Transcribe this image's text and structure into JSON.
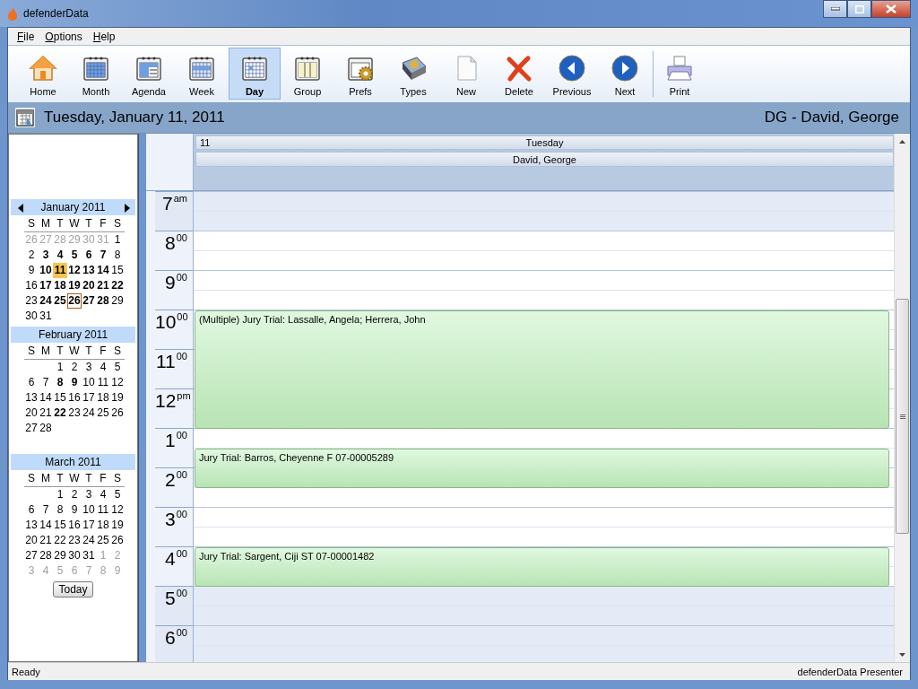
{
  "window": {
    "title": "defenderData"
  },
  "menu": [
    {
      "label": "File"
    },
    {
      "label": "Options"
    },
    {
      "label": "Help"
    }
  ],
  "toolbar": {
    "groups": [
      {
        "buttons": [
          {
            "label": "Home",
            "selected": false
          },
          {
            "label": "Month",
            "selected": false
          },
          {
            "label": "Agenda",
            "selected": false
          },
          {
            "label": "Week",
            "selected": false
          },
          {
            "label": "Day",
            "selected": true
          },
          {
            "label": "Group",
            "selected": false
          },
          {
            "label": "Prefs",
            "selected": false
          },
          {
            "label": "Types",
            "selected": false
          },
          {
            "label": "New",
            "selected": false
          },
          {
            "label": "Delete",
            "selected": false
          },
          {
            "label": "Previous",
            "selected": false
          },
          {
            "label": "Next",
            "selected": false
          }
        ]
      },
      {
        "buttons": [
          {
            "label": "Print",
            "selected": false
          }
        ]
      }
    ]
  },
  "date_header": {
    "date": "Tuesday, January 11, 2011",
    "person": "DG - David, George"
  },
  "mini_calendar": {
    "months": [
      {
        "title": "January 2011",
        "nav": true,
        "weekdays": [
          "S",
          "M",
          "T",
          "W",
          "T",
          "F",
          "S"
        ],
        "weeks": [
          [
            {
              "day": "26",
              "muted": true,
              "bold": false,
              "selected": false,
              "today": false
            },
            {
              "day": "27",
              "muted": true,
              "bold": false,
              "selected": false,
              "today": false
            },
            {
              "day": "28",
              "muted": true,
              "bold": false,
              "selected": false,
              "today": false
            },
            {
              "day": "29",
              "muted": true,
              "bold": false,
              "selected": false,
              "today": false
            },
            {
              "day": "30",
              "muted": true,
              "bold": false,
              "selected": false,
              "today": false
            },
            {
              "day": "31",
              "muted": true,
              "bold": false,
              "selected": false,
              "today": false
            },
            {
              "day": "1",
              "muted": false,
              "bold": false,
              "selected": false,
              "today": false
            }
          ],
          [
            {
              "day": "2",
              "muted": false,
              "bold": false,
              "selected": false,
              "today": false
            },
            {
              "day": "3",
              "muted": false,
              "bold": true,
              "selected": false,
              "today": false
            },
            {
              "day": "4",
              "muted": false,
              "bold": true,
              "selected": false,
              "today": false
            },
            {
              "day": "5",
              "muted": false,
              "bold": true,
              "selected": false,
              "today": false
            },
            {
              "day": "6",
              "muted": false,
              "bold": true,
              "selected": false,
              "today": false
            },
            {
              "day": "7",
              "muted": false,
              "bold": true,
              "selected": false,
              "today": false
            },
            {
              "day": "8",
              "muted": false,
              "bold": false,
              "selected": false,
              "today": false
            }
          ],
          [
            {
              "day": "9",
              "muted": false,
              "bold": false,
              "selected": false,
              "today": false
            },
            {
              "day": "10",
              "muted": false,
              "bold": true,
              "selected": false,
              "today": false
            },
            {
              "day": "11",
              "muted": false,
              "bold": true,
              "selected": true,
              "today": false
            },
            {
              "day": "12",
              "muted": false,
              "bold": true,
              "selected": false,
              "today": false
            },
            {
              "day": "13",
              "muted": false,
              "bold": true,
              "selected": false,
              "today": false
            },
            {
              "day": "14",
              "muted": false,
              "bold": true,
              "selected": false,
              "today": false
            },
            {
              "day": "15",
              "muted": false,
              "bold": false,
              "selected": false,
              "today": false
            }
          ],
          [
            {
              "day": "16",
              "muted": false,
              "bold": false,
              "selected": false,
              "today": false
            },
            {
              "day": "17",
              "muted": false,
              "bold": true,
              "selected": false,
              "today": false
            },
            {
              "day": "18",
              "muted": false,
              "bold": true,
              "selected": false,
              "today": false
            },
            {
              "day": "19",
              "muted": false,
              "bold": true,
              "selected": false,
              "today": false
            },
            {
              "day": "20",
              "muted": false,
              "bold": true,
              "selected": false,
              "today": false
            },
            {
              "day": "21",
              "muted": false,
              "bold": true,
              "selected": false,
              "today": false
            },
            {
              "day": "22",
              "muted": false,
              "bold": true,
              "selected": false,
              "today": false
            }
          ],
          [
            {
              "day": "23",
              "muted": false,
              "bold": false,
              "selected": false,
              "today": false
            },
            {
              "day": "24",
              "muted": false,
              "bold": true,
              "selected": false,
              "today": false
            },
            {
              "day": "25",
              "muted": false,
              "bold": true,
              "selected": false,
              "today": false
            },
            {
              "day": "26",
              "muted": false,
              "bold": true,
              "selected": false,
              "today": true
            },
            {
              "day": "27",
              "muted": false,
              "bold": true,
              "selected": false,
              "today": false
            },
            {
              "day": "28",
              "muted": false,
              "bold": true,
              "selected": false,
              "today": false
            },
            {
              "day": "29",
              "muted": false,
              "bold": false,
              "selected": false,
              "today": false
            }
          ],
          [
            {
              "day": "30",
              "muted": false,
              "bold": false,
              "selected": false,
              "today": false
            },
            {
              "day": "31",
              "muted": false,
              "bold": false,
              "selected": false,
              "today": false
            }
          ]
        ]
      },
      {
        "title": "February 2011",
        "nav": false,
        "weekdays": [
          "S",
          "M",
          "T",
          "W",
          "T",
          "F",
          "S"
        ],
        "weeks": [
          [
            {
              "day": "1",
              "muted": false,
              "bold": false,
              "selected": false,
              "today": false
            },
            {
              "day": "2",
              "muted": false,
              "bold": false,
              "selected": false,
              "today": false
            },
            {
              "day": "3",
              "muted": false,
              "bold": false,
              "selected": false,
              "today": false
            },
            {
              "day": "4",
              "muted": false,
              "bold": false,
              "selected": false,
              "today": false
            },
            {
              "day": "5",
              "muted": false,
              "bold": false,
              "selected": false,
              "today": false
            }
          ],
          [
            {
              "day": "6",
              "muted": false,
              "bold": false,
              "selected": false,
              "today": false
            },
            {
              "day": "7",
              "muted": false,
              "bold": false,
              "selected": false,
              "today": false
            },
            {
              "day": "8",
              "muted": false,
              "bold": true,
              "selected": false,
              "today": false
            },
            {
              "day": "9",
              "muted": false,
              "bold": true,
              "selected": false,
              "today": false
            },
            {
              "day": "10",
              "muted": false,
              "bold": false,
              "selected": false,
              "today": false
            },
            {
              "day": "11",
              "muted": false,
              "bold": false,
              "selected": false,
              "today": false
            },
            {
              "day": "12",
              "muted": false,
              "bold": false,
              "selected": false,
              "today": false
            }
          ],
          [
            {
              "day": "13",
              "muted": false,
              "bold": false,
              "selected": false,
              "today": false
            },
            {
              "day": "14",
              "muted": false,
              "bold": false,
              "selected": false,
              "today": false
            },
            {
              "day": "15",
              "muted": false,
              "bold": false,
              "selected": false,
              "today": false
            },
            {
              "day": "16",
              "muted": false,
              "bold": false,
              "selected": false,
              "today": false
            },
            {
              "day": "17",
              "muted": false,
              "bold": false,
              "selected": false,
              "today": false
            },
            {
              "day": "18",
              "muted": false,
              "bold": false,
              "selected": false,
              "today": false
            },
            {
              "day": "19",
              "muted": false,
              "bold": false,
              "selected": false,
              "today": false
            }
          ],
          [
            {
              "day": "20",
              "muted": false,
              "bold": false,
              "selected": false,
              "today": false
            },
            {
              "day": "21",
              "muted": false,
              "bold": false,
              "selected": false,
              "today": false
            },
            {
              "day": "22",
              "muted": false,
              "bold": true,
              "selected": false,
              "today": false
            },
            {
              "day": "23",
              "muted": false,
              "bold": false,
              "selected": false,
              "today": false
            },
            {
              "day": "24",
              "muted": false,
              "bold": false,
              "selected": false,
              "today": false
            },
            {
              "day": "25",
              "muted": false,
              "bold": false,
              "selected": false,
              "today": false
            },
            {
              "day": "26",
              "muted": false,
              "bold": false,
              "selected": false,
              "today": false
            }
          ],
          [
            {
              "day": "27",
              "muted": false,
              "bold": false,
              "selected": false,
              "today": false
            },
            {
              "day": "28",
              "muted": false,
              "bold": false,
              "selected": false,
              "today": false
            }
          ]
        ]
      },
      {
        "title": "March 2011",
        "nav": false,
        "weekdays": [
          "S",
          "M",
          "T",
          "W",
          "T",
          "F",
          "S"
        ],
        "weeks": [
          [
            {
              "day": "1",
              "muted": false,
              "bold": false,
              "selected": false,
              "today": false
            },
            {
              "day": "2",
              "muted": false,
              "bold": false,
              "selected": false,
              "today": false
            },
            {
              "day": "3",
              "muted": false,
              "bold": false,
              "selected": false,
              "today": false
            },
            {
              "day": "4",
              "muted": false,
              "bold": false,
              "selected": false,
              "today": false
            },
            {
              "day": "5",
              "muted": false,
              "bold": false,
              "selected": false,
              "today": false
            }
          ],
          [
            {
              "day": "6",
              "muted": false,
              "bold": false,
              "selected": false,
              "today": false
            },
            {
              "day": "7",
              "muted": false,
              "bold": false,
              "selected": false,
              "today": false
            },
            {
              "day": "8",
              "muted": false,
              "bold": false,
              "selected": false,
              "today": false
            },
            {
              "day": "9",
              "muted": false,
              "bold": false,
              "selected": false,
              "today": false
            },
            {
              "day": "10",
              "muted": false,
              "bold": false,
              "selected": false,
              "today": false
            },
            {
              "day": "11",
              "muted": false,
              "bold": false,
              "selected": false,
              "today": false
            },
            {
              "day": "12",
              "muted": false,
              "bold": false,
              "selected": false,
              "today": false
            }
          ],
          [
            {
              "day": "13",
              "muted": false,
              "bold": false,
              "selected": false,
              "today": false
            },
            {
              "day": "14",
              "muted": false,
              "bold": false,
              "selected": false,
              "today": false
            },
            {
              "day": "15",
              "muted": false,
              "bold": false,
              "selected": false,
              "today": false
            },
            {
              "day": "16",
              "muted": false,
              "bold": false,
              "selected": false,
              "today": false
            },
            {
              "day": "17",
              "muted": false,
              "bold": false,
              "selected": false,
              "today": false
            },
            {
              "day": "18",
              "muted": false,
              "bold": false,
              "selected": false,
              "today": false
            },
            {
              "day": "19",
              "muted": false,
              "bold": false,
              "selected": false,
              "today": false
            }
          ],
          [
            {
              "day": "20",
              "muted": false,
              "bold": false,
              "selected": false,
              "today": false
            },
            {
              "day": "21",
              "muted": false,
              "bold": false,
              "selected": false,
              "today": false
            },
            {
              "day": "22",
              "muted": false,
              "bold": false,
              "selected": false,
              "today": false
            },
            {
              "day": "23",
              "muted": false,
              "bold": false,
              "selected": false,
              "today": false
            },
            {
              "day": "24",
              "muted": false,
              "bold": false,
              "selected": false,
              "today": false
            },
            {
              "day": "25",
              "muted": false,
              "bold": false,
              "selected": false,
              "today": false
            },
            {
              "day": "26",
              "muted": false,
              "bold": false,
              "selected": false,
              "today": false
            }
          ],
          [
            {
              "day": "27",
              "muted": false,
              "bold": false,
              "selected": false,
              "today": false
            },
            {
              "day": "28",
              "muted": false,
              "bold": false,
              "selected": false,
              "today": false
            },
            {
              "day": "29",
              "muted": false,
              "bold": false,
              "selected": false,
              "today": false
            },
            {
              "day": "30",
              "muted": false,
              "bold": false,
              "selected": false,
              "today": false
            },
            {
              "day": "31",
              "muted": false,
              "bold": false,
              "selected": false,
              "today": false
            },
            {
              "day": "1",
              "muted": true,
              "bold": false,
              "selected": false,
              "today": false
            },
            {
              "day": "2",
              "muted": true,
              "bold": false,
              "selected": false,
              "today": false
            }
          ],
          [
            {
              "day": "3",
              "muted": true,
              "bold": false,
              "selected": false,
              "today": false
            },
            {
              "day": "4",
              "muted": true,
              "bold": false,
              "selected": false,
              "today": false
            },
            {
              "day": "5",
              "muted": true,
              "bold": false,
              "selected": false,
              "today": false
            },
            {
              "day": "6",
              "muted": true,
              "bold": false,
              "selected": false,
              "today": false
            },
            {
              "day": "7",
              "muted": true,
              "bold": false,
              "selected": false,
              "today": false
            },
            {
              "day": "8",
              "muted": true,
              "bold": false,
              "selected": false,
              "today": false
            },
            {
              "day": "9",
              "muted": true,
              "bold": false,
              "selected": false,
              "today": false
            }
          ]
        ]
      }
    ],
    "today_button": "Today"
  },
  "day_view": {
    "date_number": "11",
    "weekday": "Tuesday",
    "resource": "David, George",
    "hours": [
      {
        "hour": "7",
        "suffix": "am",
        "working": false,
        "halves": [
          {
            "busy": false
          },
          {
            "busy": false
          }
        ]
      },
      {
        "hour": "8",
        "suffix": "00",
        "working": true,
        "halves": [
          {
            "busy": false
          },
          {
            "busy": false
          }
        ]
      },
      {
        "hour": "9",
        "suffix": "00",
        "working": true,
        "halves": [
          {
            "busy": false
          },
          {
            "busy": false
          }
        ]
      },
      {
        "hour": "10",
        "suffix": "00",
        "working": true,
        "halves": [
          {
            "busy": true,
            "text": "(Multiple) Jury Trial: Lassalle, Angela; Herrera, John"
          },
          {
            "busy": true
          }
        ]
      },
      {
        "hour": "11",
        "suffix": "00",
        "working": true,
        "halves": [
          {
            "busy": true
          },
          {
            "busy": true
          }
        ]
      },
      {
        "hour": "12",
        "suffix": "pm",
        "working": true,
        "halves": [
          {
            "busy": true
          },
          {
            "busy": true
          }
        ]
      },
      {
        "hour": "1",
        "suffix": "00",
        "working": true,
        "halves": [
          {
            "busy": false
          },
          {
            "busy": true,
            "text": "Jury Trial: Barros, Cheyenne F  07-00005289"
          }
        ]
      },
      {
        "hour": "2",
        "suffix": "00",
        "working": true,
        "halves": [
          {
            "busy": true
          },
          {
            "busy": false
          }
        ]
      },
      {
        "hour": "3",
        "suffix": "00",
        "working": true,
        "halves": [
          {
            "busy": false
          },
          {
            "busy": false
          }
        ]
      },
      {
        "hour": "4",
        "suffix": "00",
        "working": true,
        "halves": [
          {
            "busy": true,
            "text": "Jury Trial: Sargent, Ciji ST 07-00001482"
          },
          {
            "busy": true
          }
        ]
      },
      {
        "hour": "5",
        "suffix": "00",
        "working": false,
        "halves": [
          {
            "busy": false
          },
          {
            "busy": false
          }
        ]
      },
      {
        "hour": "6",
        "suffix": "00",
        "working": false,
        "halves": [
          {
            "busy": false
          },
          {
            "busy": false
          }
        ]
      }
    ]
  },
  "status_bar": {
    "left": "Ready",
    "right": "defenderData Presenter"
  }
}
